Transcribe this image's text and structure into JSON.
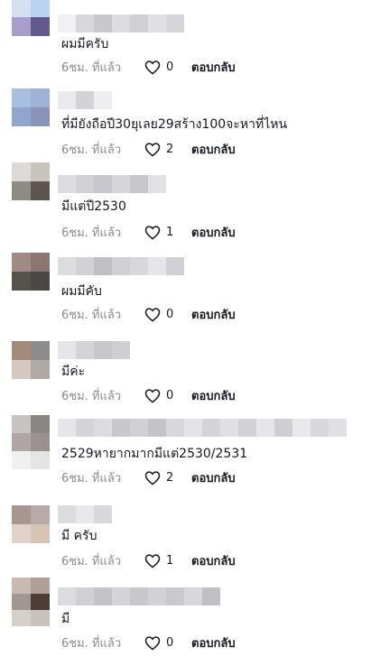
{
  "comments": [
    {
      "text": "ผมมีครับ",
      "time": "6ชม. ที่แล้ว",
      "likes": "0",
      "reply": "ตอบกลับ"
    },
    {
      "text": "ที่มียังถือปี30ยุเลย29สร้าง100จะหาที่ไหน",
      "time": "6ชม. ที่แล้ว",
      "likes": "2",
      "reply": "ตอบกลับ"
    },
    {
      "text": "มีแต่ปี2530",
      "time": "6ชม. ที่แล้ว",
      "likes": "1",
      "reply": "ตอบกลับ"
    },
    {
      "text": "ผมมีคับ",
      "time": "6ชม. ที่แล้ว",
      "likes": "0",
      "reply": "ตอบกลับ"
    },
    {
      "text": "มีค่ะ",
      "time": "6ชม. ที่แล้ว",
      "likes": "0",
      "reply": "ตอบกลับ"
    },
    {
      "text": "2529หายากมากมีแต่2530/2531",
      "time": "6ชม. ที่แล้ว",
      "likes": "2",
      "reply": "ตอบกลับ"
    },
    {
      "text": "มี ครับ",
      "time": "6ชม. ที่แล้ว",
      "likes": "1",
      "reply": "ตอบกลับ"
    },
    {
      "text": "มี",
      "time": "6ชม. ที่แล้ว",
      "likes": "0",
      "reply": "ตอบกลับ"
    }
  ],
  "colors": {
    "text": "#161823",
    "meta": "#8a8b91"
  },
  "icons": {
    "like": "heart-outline-icon",
    "avatar": "pixelated-avatar",
    "username": "blurred-username"
  }
}
